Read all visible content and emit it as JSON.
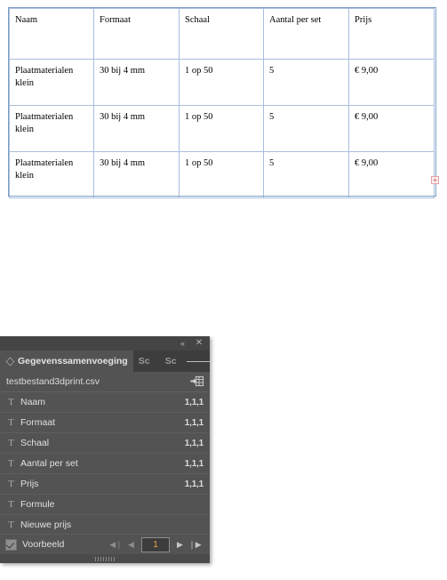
{
  "document": {
    "table": {
      "headers": [
        "Naam",
        "Formaat",
        "Schaal",
        "Aantal per set",
        "Prijs"
      ],
      "rows": [
        [
          "Plaatmaterialen klein",
          "30 bij 4 mm",
          "1 op 50",
          "5",
          "€ 9,00"
        ],
        [
          "Plaatmaterialen klein",
          "30 bij 4 mm",
          "1 op 50",
          "5",
          "€ 9,00"
        ],
        [
          "Plaatmaterialen klein",
          "30 bij 4 mm",
          "1 op 50",
          "5",
          "€ 9,00"
        ]
      ],
      "border_color": "#a8bfdd",
      "frame_color": "#7f9fc4"
    },
    "overset_indicator": {
      "symbol": "+",
      "color": "#e08a8f"
    }
  },
  "panel": {
    "titlebar": {
      "collapse_label": "«",
      "close_label": "✕"
    },
    "tabs": [
      {
        "label": "Gegevenssamenvoeging",
        "active": true
      },
      {
        "label": "Sc",
        "active": false
      },
      {
        "label": "Sc",
        "active": false
      }
    ],
    "menu_label": "panel-menu",
    "source": {
      "file_name": "testbestand3dprint.csv",
      "merge_icon_name": "create-merged-document-icon"
    },
    "fields": [
      {
        "type_icon": "T",
        "name": "Naam",
        "badge": "1,1,1"
      },
      {
        "type_icon": "T",
        "name": "Formaat",
        "badge": "1,1,1"
      },
      {
        "type_icon": "T",
        "name": "Schaal",
        "badge": "1,1,1"
      },
      {
        "type_icon": "T",
        "name": "Aantal per set",
        "badge": "1,1,1"
      },
      {
        "type_icon": "T",
        "name": "Prijs",
        "badge": "1,1,1"
      },
      {
        "type_icon": "T",
        "name": "Formule",
        "badge": ""
      },
      {
        "type_icon": "T",
        "name": "Nieuwe prijs",
        "badge": ""
      }
    ],
    "footer": {
      "preview_label": "Voorbeeld",
      "preview_checked": true,
      "nav": {
        "first_label": "◀❘",
        "prev_label": "◀",
        "record_value": "1",
        "next_label": "▶",
        "last_label": "❘▶"
      },
      "record_value_color": "#e8a33d"
    }
  }
}
